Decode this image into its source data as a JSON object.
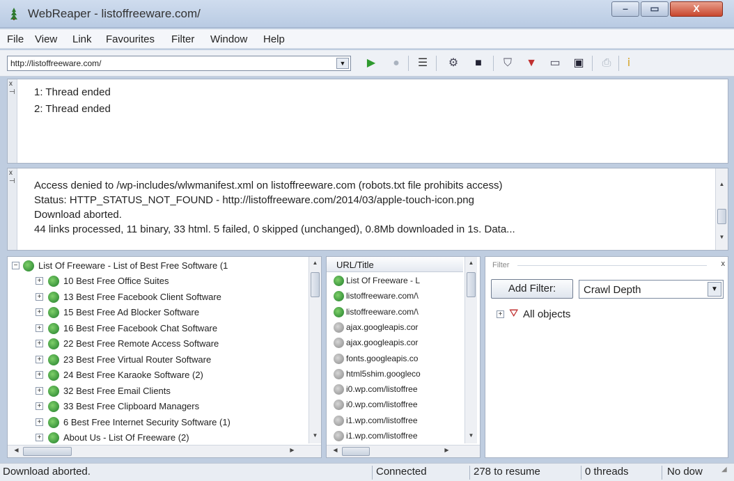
{
  "window": {
    "title": "WebReaper - listoffreeware.com/",
    "min_glyph": "–",
    "max_glyph": "▭",
    "close_glyph": "X"
  },
  "menu": [
    "File",
    "View",
    "Link",
    "Favourites",
    "Filter",
    "Window",
    "Help"
  ],
  "toolbar": {
    "url_value": "http://listoffreeware.com/",
    "icons": [
      "play-icon",
      "stop-icon",
      "list-icon",
      "settings-icon",
      "save-icon",
      "filter-wizard-icon",
      "filter-icon",
      "export-icon",
      "disk-icon",
      "print-icon",
      "info-icon"
    ]
  },
  "threads": {
    "lines": [
      "1: Thread ended",
      "2: Thread ended"
    ]
  },
  "log": {
    "lines": [
      "Access denied to /wp-includes/wlwmanifest.xml on listoffreeware.com (robots.txt file prohibits access)",
      "Status: HTTP_STATUS_NOT_FOUND - http://listoffreeware.com/2014/03/apple-touch-icon.png",
      "Download aborted.",
      "44 links processed, 11 binary, 33 html. 5 failed, 0 skipped (unchanged), 0.8Mb downloaded in 1s. Data..."
    ]
  },
  "tree": {
    "root": "List Of Freeware - List of Best Free Software (1",
    "items": [
      "10 Best Free Office Suites",
      "13 Best Free Facebook Client Software",
      "15 Best Free Ad Blocker Software",
      "16 Best Free Facebook Chat Software",
      "22 Best Free Remote Access Software",
      "23 Best Free Virtual Router Software",
      "24 Best Free Karaoke Software (2)",
      "32 Best Free Email Clients",
      "33 Best Free Clipboard Managers",
      "6 Best Free Internet Security Software (1)",
      "About Us - List Of Freeware (2)"
    ]
  },
  "url_list": {
    "header": "URL/Title",
    "rows": [
      {
        "text": "List Of Freeware - L",
        "icon": "green"
      },
      {
        "text": "listoffreeware.com/\\",
        "icon": "green"
      },
      {
        "text": "listoffreeware.com/\\",
        "icon": "green"
      },
      {
        "text": "ajax.googleapis.cor",
        "icon": "grey"
      },
      {
        "text": "ajax.googleapis.cor",
        "icon": "grey"
      },
      {
        "text": "fonts.googleapis.co",
        "icon": "grey"
      },
      {
        "text": "html5shim.googleco",
        "icon": "grey"
      },
      {
        "text": "i0.wp.com/listoffree",
        "icon": "grey"
      },
      {
        "text": "i0.wp.com/listoffree",
        "icon": "grey"
      },
      {
        "text": "i1.wp.com/listoffree",
        "icon": "grey"
      },
      {
        "text": "i1.wp.com/listoffree",
        "icon": "grey"
      }
    ]
  },
  "filter": {
    "caption": "Filter",
    "add_button": "Add Filter:",
    "select_value": "Crawl Depth",
    "tree_root": "All objects"
  },
  "status": {
    "message": "Download aborted.",
    "connection": "Connected",
    "resume": "278 to resume",
    "threads": "0 threads",
    "download": "No dow"
  },
  "colors": {
    "close_button": "#c8472e",
    "node_icon": "#1f7d2a",
    "chrome": "#bfcde0"
  }
}
